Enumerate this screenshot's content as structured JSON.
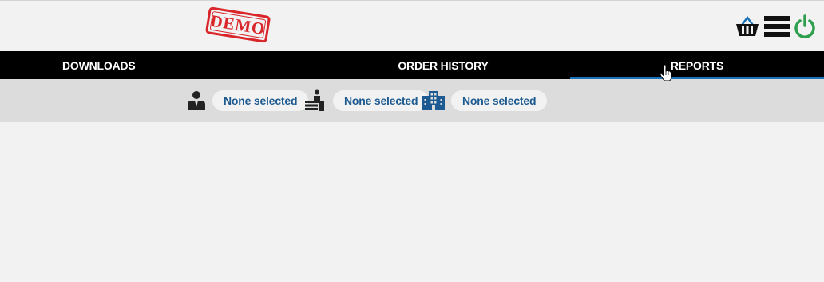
{
  "stamp": {
    "text": "DEMO"
  },
  "header": {
    "icons": [
      "basket-icon",
      "menu-icon",
      "power-icon"
    ]
  },
  "nav": {
    "tabs": [
      {
        "label": "DOWNLOADS"
      },
      {
        "label": "ORDER HISTORY"
      },
      {
        "label": "REPORTS",
        "active": true
      }
    ]
  },
  "filters": [
    {
      "icon": "user-icon",
      "value": "None selected"
    },
    {
      "icon": "desk-icon",
      "value": "None selected"
    },
    {
      "icon": "building-icon",
      "value": "None selected"
    }
  ],
  "colors": {
    "navbar_bg": "#000000",
    "active_tab_underline": "#1a73b8",
    "filterbar_bg": "#dcdcdc",
    "pill_text": "#1d5a91",
    "stamp_red": "#d9262b",
    "power_green": "#2e9e4f"
  }
}
